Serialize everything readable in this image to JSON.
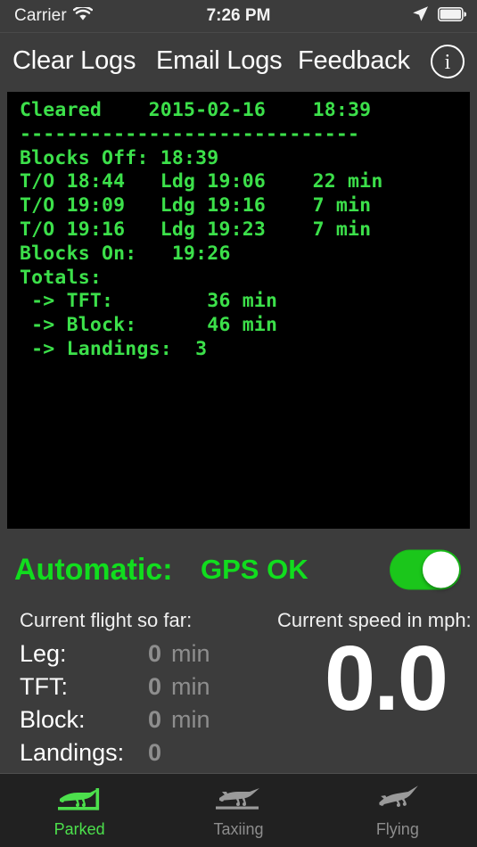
{
  "status_bar": {
    "carrier": "Carrier",
    "wifi_icon": "wifi-icon",
    "time": "7:26 PM",
    "location_icon": "location-arrow-icon",
    "battery_icon": "battery-full-icon"
  },
  "toolbar": {
    "clear_logs": "Clear Logs",
    "email_logs": "Email Logs",
    "feedback": "Feedback",
    "info": "i"
  },
  "console": {
    "text": "Cleared    2015-02-16    18:39\n-----------------------------\nBlocks Off: 18:39\nT/O 18:44   Ldg 19:06    22 min\nT/O 19:09   Ldg 19:16    7 min\nT/O 19:16   Ldg 19:23    7 min\nBlocks On:   19:26\nTotals:\n -> TFT:        36 min\n -> Block:      46 min\n -> Landings:  3",
    "lines": [
      "Cleared    2015-02-16    18:39",
      "-----------------------------",
      "Blocks Off: 18:39",
      "T/O 18:44   Ldg 19:06    22 min",
      "T/O 19:09   Ldg 19:16    7 min",
      "T/O 19:16   Ldg 19:23    7 min",
      "Blocks On:   19:26",
      "Totals:",
      " -> TFT:        36 min",
      " -> Block:      46 min",
      " -> Landings:  3"
    ],
    "text_color": "#3ce04a",
    "background_color": "#000000"
  },
  "automatic": {
    "label": "Automatic:",
    "gps_status": "GPS OK",
    "toggle_on": true,
    "toggle_color": "#1bc61b",
    "text_color": "#11dd1e"
  },
  "stats": {
    "left_header": "Current flight so far:",
    "right_header": "Current speed in mph:",
    "rows": [
      {
        "name": "Leg:",
        "value": "0",
        "unit": "min"
      },
      {
        "name": "TFT:",
        "value": "0",
        "unit": "min"
      },
      {
        "name": "Block:",
        "value": "0",
        "unit": "min"
      },
      {
        "name": "Landings:",
        "value": "0",
        "unit": ""
      }
    ],
    "speed": "0.0"
  },
  "tabs": [
    {
      "label": "Parked",
      "icon": "airplane-parked-icon",
      "active": true
    },
    {
      "label": "Taxiing",
      "icon": "airplane-taxiing-icon",
      "active": false
    },
    {
      "label": "Flying",
      "icon": "airplane-flying-icon",
      "active": false
    }
  ]
}
